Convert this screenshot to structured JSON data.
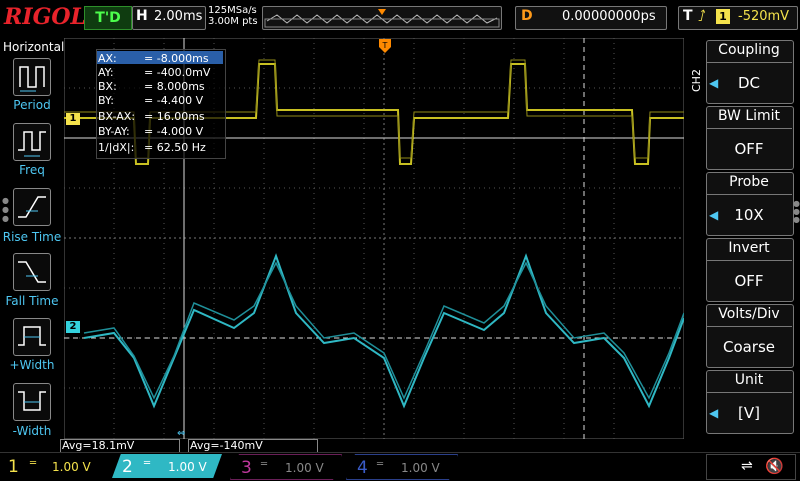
{
  "brand": "RIGOL",
  "run_status": "T'D",
  "timebase": {
    "letter": "H",
    "value": "2.00ms"
  },
  "sampling": {
    "rate": "125MSa/s",
    "points": "3.00M pts"
  },
  "trigger_position": {
    "letter": "D",
    "value": "0.00000000ps"
  },
  "trigger": {
    "letter": "T",
    "edge_icon": "rising-edge-icon",
    "source": "1",
    "level": "-520mV"
  },
  "left_panel": {
    "title": "Horizontal",
    "buttons": [
      {
        "label": "Period",
        "icon": "period-measure-icon"
      },
      {
        "label": "Freq",
        "icon": "frequency-measure-icon"
      },
      {
        "label": "Rise Time",
        "icon": "rise-time-icon"
      },
      {
        "label": "Fall Time",
        "icon": "fall-time-icon"
      },
      {
        "label": "+Width",
        "icon": "positive-width-icon"
      },
      {
        "label": "-Width",
        "icon": "negative-width-icon"
      }
    ]
  },
  "cursor_readout": [
    {
      "name": "AX:",
      "value": "-8.000ms"
    },
    {
      "name": "AY:",
      "value": "-400.0mV"
    },
    {
      "name": "BX:",
      "value": "8.000ms"
    },
    {
      "name": "BY:",
      "value": "-4.400 V"
    },
    {
      "name": "BX-AX:",
      "value": "16.00ms"
    },
    {
      "name": "BY-AY:",
      "value": "-4.000 V"
    },
    {
      "name": "1/|dX|:",
      "value": "62.50 Hz"
    }
  ],
  "channel_markers": {
    "ch1": "1",
    "ch2": "2"
  },
  "avg": {
    "ch1": "Avg=18.1mV",
    "ch2": "Avg=-140mV"
  },
  "right_panel": {
    "channel_tag": "CH2",
    "menus": [
      {
        "title": "Coupling",
        "value": "DC"
      },
      {
        "title": "BW Limit",
        "value": "OFF"
      },
      {
        "title": "Probe",
        "value": "10X"
      },
      {
        "title": "Invert",
        "value": "OFF"
      },
      {
        "title": "Volts/Div",
        "value": "Coarse"
      },
      {
        "title": "Unit",
        "value": "[V]"
      }
    ]
  },
  "channels": [
    {
      "num": "1",
      "scale": "1.00 V",
      "color": "#f4e24c",
      "active": true
    },
    {
      "num": "2",
      "scale": "1.00 V",
      "color": "#34d2de",
      "active": true
    },
    {
      "num": "3",
      "scale": "1.00 V",
      "color": "#c0389e",
      "active": false
    },
    {
      "num": "4",
      "scale": "1.00 V",
      "color": "#3a5cc8",
      "active": false
    }
  ],
  "colors": {
    "ch1": "#c8c022",
    "ch2": "#2fb8c4",
    "trigger": "#ff8a00",
    "accent": "#4ec7f2"
  }
}
